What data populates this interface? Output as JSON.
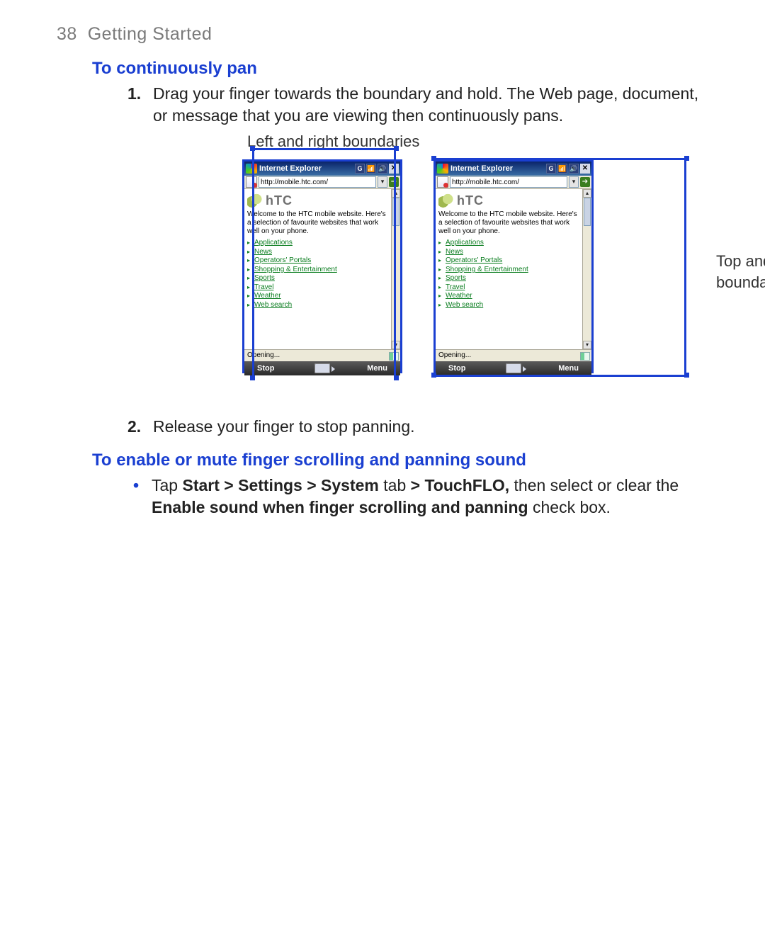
{
  "page": {
    "number": "38",
    "chapter": "Getting Started"
  },
  "section1": {
    "title": "To continuously pan",
    "step1": "Drag your finger towards the boundary and hold. The Web page, document, or message that you are viewing then continuously pans.",
    "step2": "Release your finger to stop panning."
  },
  "figure": {
    "left_caption": "Left and right boundaries",
    "right_caption": "Top and bottom boundaries"
  },
  "phone": {
    "app_title": "Internet Explorer",
    "url": "http://mobile.htc.com/",
    "tray_g": "G",
    "brand": "hTC",
    "welcome": "Welcome to the HTC mobile website. Here's a selection of favourite websites that work well on your phone.",
    "links": {
      "0": "Applications",
      "1": "News",
      "2": "Operators' Portals",
      "3": "Shopping & Entertainment",
      "4": "Sports",
      "5": "Travel",
      "6": "Weather",
      "7": "Web search"
    },
    "status": "Opening...",
    "soft_left": "Stop",
    "soft_right": "Menu"
  },
  "section2": {
    "title": "To enable or mute finger scrolling and panning sound",
    "bullet_pre": "Tap ",
    "bullet_path": "Start > Settings > System",
    "bullet_mid1": " tab ",
    "bullet_path2": "> TouchFLO,",
    "bullet_mid2": " then select or clear the ",
    "bullet_bold": "Enable sound when finger scrolling and panning",
    "bullet_post": " check box."
  }
}
